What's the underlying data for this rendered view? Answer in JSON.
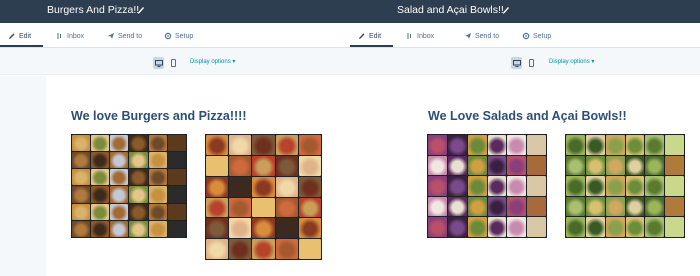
{
  "tabs": [
    {
      "label": "Edit",
      "icon": "pencil-icon"
    },
    {
      "label": "Inbox",
      "icon": "inbox-icon"
    },
    {
      "label": "Send to",
      "icon": "send-icon"
    },
    {
      "label": "Setup",
      "icon": "gear-icon"
    }
  ],
  "display_options_label": "Display options ▾",
  "colors": {
    "topbar": "#2d3e50",
    "heading": "#2d4e75",
    "link": "#0091ae",
    "collage_bg": "#1e2126"
  },
  "panels": {
    "left": {
      "title": "Burgers And Pizza!!",
      "heading": "We love Burgers and Pizza!!!!",
      "collages": [
        {
          "subject": "burger image results",
          "palette": [
            "#8b5a2b",
            "#c8913f",
            "#5b3a1e",
            "#d9b26b",
            "#3e2a1a",
            "#a36a31",
            "#e3c58a",
            "#6f4a2a",
            "#2b2b2b",
            "#b07a3c",
            "#7a8c3a",
            "#c2c9d6"
          ]
        },
        {
          "subject": "pizza image results",
          "palette": [
            "#b8432a",
            "#d98c3a",
            "#e8c070",
            "#8a3a22",
            "#c9a05a",
            "#6e2f1e",
            "#e0b48a",
            "#a45a2e",
            "#3a2a20",
            "#cf6a3d",
            "#f0d9a8",
            "#7c5a3a"
          ]
        }
      ]
    },
    "right": {
      "title": "Salad and Açai Bowls!!",
      "heading": "We Love Salads and Açai Bowls!!",
      "collages": [
        {
          "subject": "acai bowl image results",
          "palette": [
            "#5a2a5e",
            "#8a3f7a",
            "#d8c8a8",
            "#b8506a",
            "#e8e0d0",
            "#6b8a3a",
            "#3a2040",
            "#c98ab0",
            "#a86a3a",
            "#f0e8e0",
            "#7a4a8a",
            "#d0a040"
          ]
        },
        {
          "subject": "salad image results",
          "palette": [
            "#6b8e3a",
            "#9bb55a",
            "#c9d88a",
            "#4a6a2a",
            "#d8c070",
            "#8aa04a",
            "#e0d0a0",
            "#5a7a30",
            "#b07a3a",
            "#a8c070",
            "#3a5a25",
            "#d0a860"
          ]
        }
      ]
    }
  }
}
